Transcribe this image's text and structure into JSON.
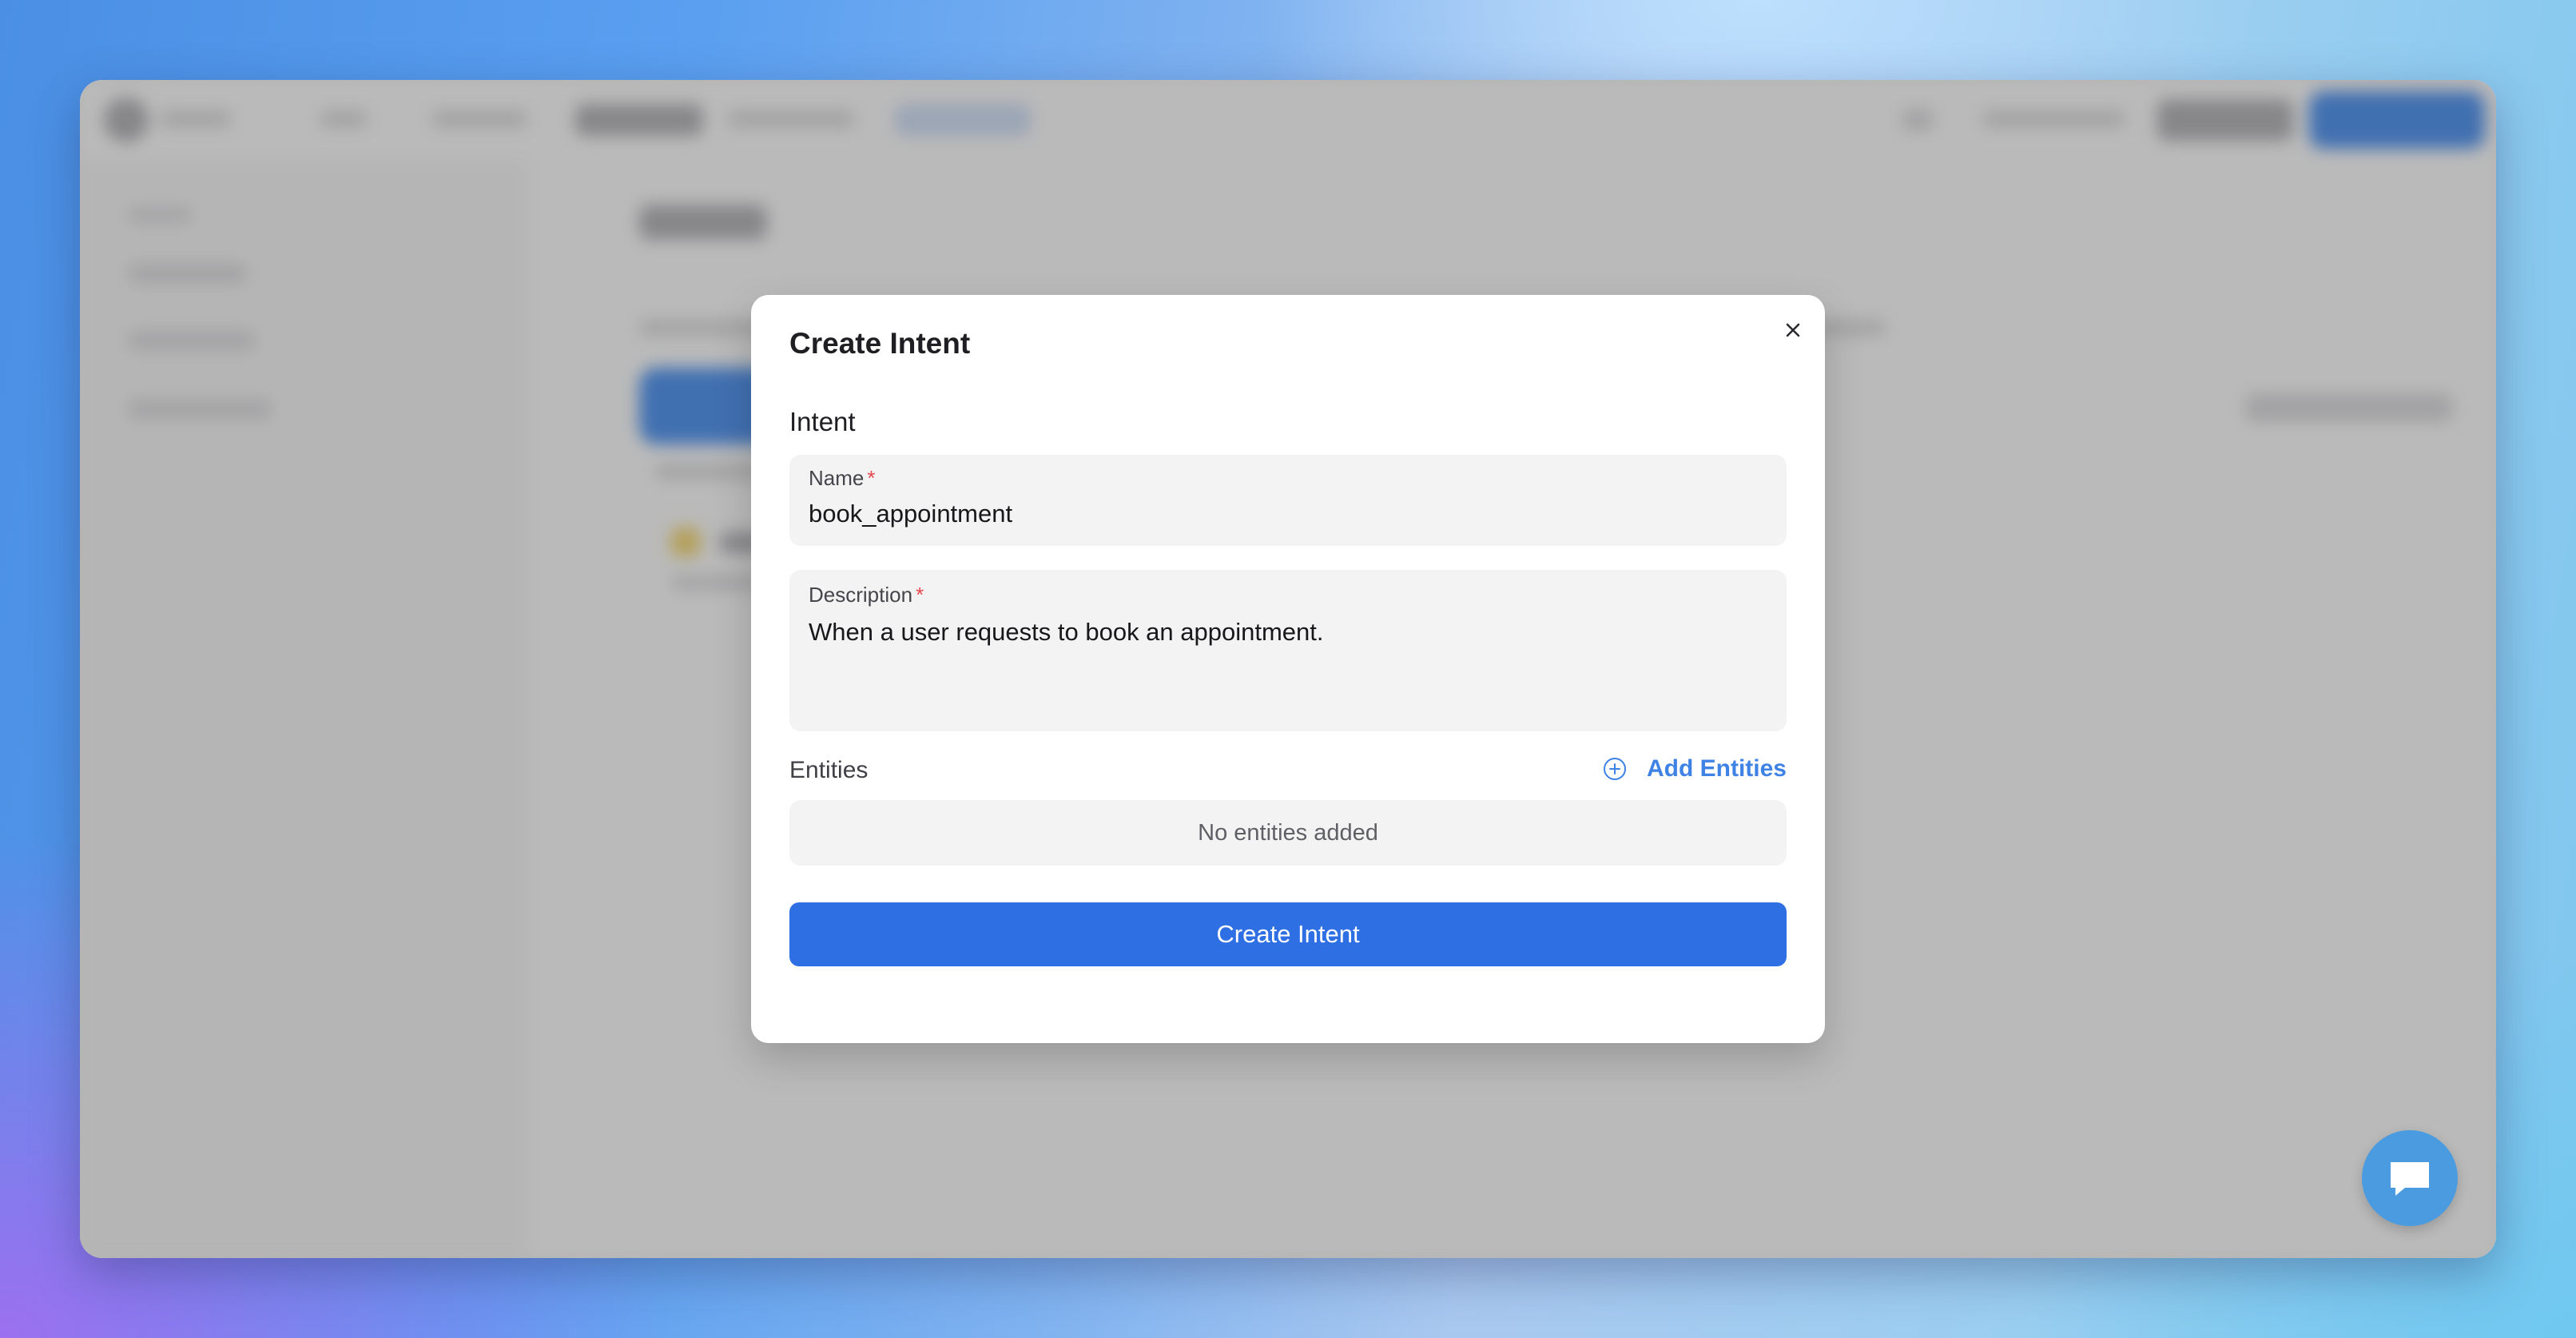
{
  "modal": {
    "title": "Create Intent",
    "section_label": "Intent",
    "name_field": {
      "label": "Name",
      "required_mark": "*",
      "value": "book_appointment"
    },
    "description_field": {
      "label": "Description",
      "required_mark": "*",
      "value": "When a user requests to book an appointment."
    },
    "entities": {
      "label": "Entities",
      "add_label": "Add Entities",
      "empty_text": "No entities added"
    },
    "submit_label": "Create Intent"
  },
  "icons": {
    "close": "close-icon",
    "add": "plus-circle-icon",
    "chat": "chat-icon"
  },
  "colors": {
    "primary_button": "#2f6fe4",
    "link_accent": "#3f82e6",
    "required": "#e5484d",
    "chat_bubble": "#4a9be0"
  }
}
